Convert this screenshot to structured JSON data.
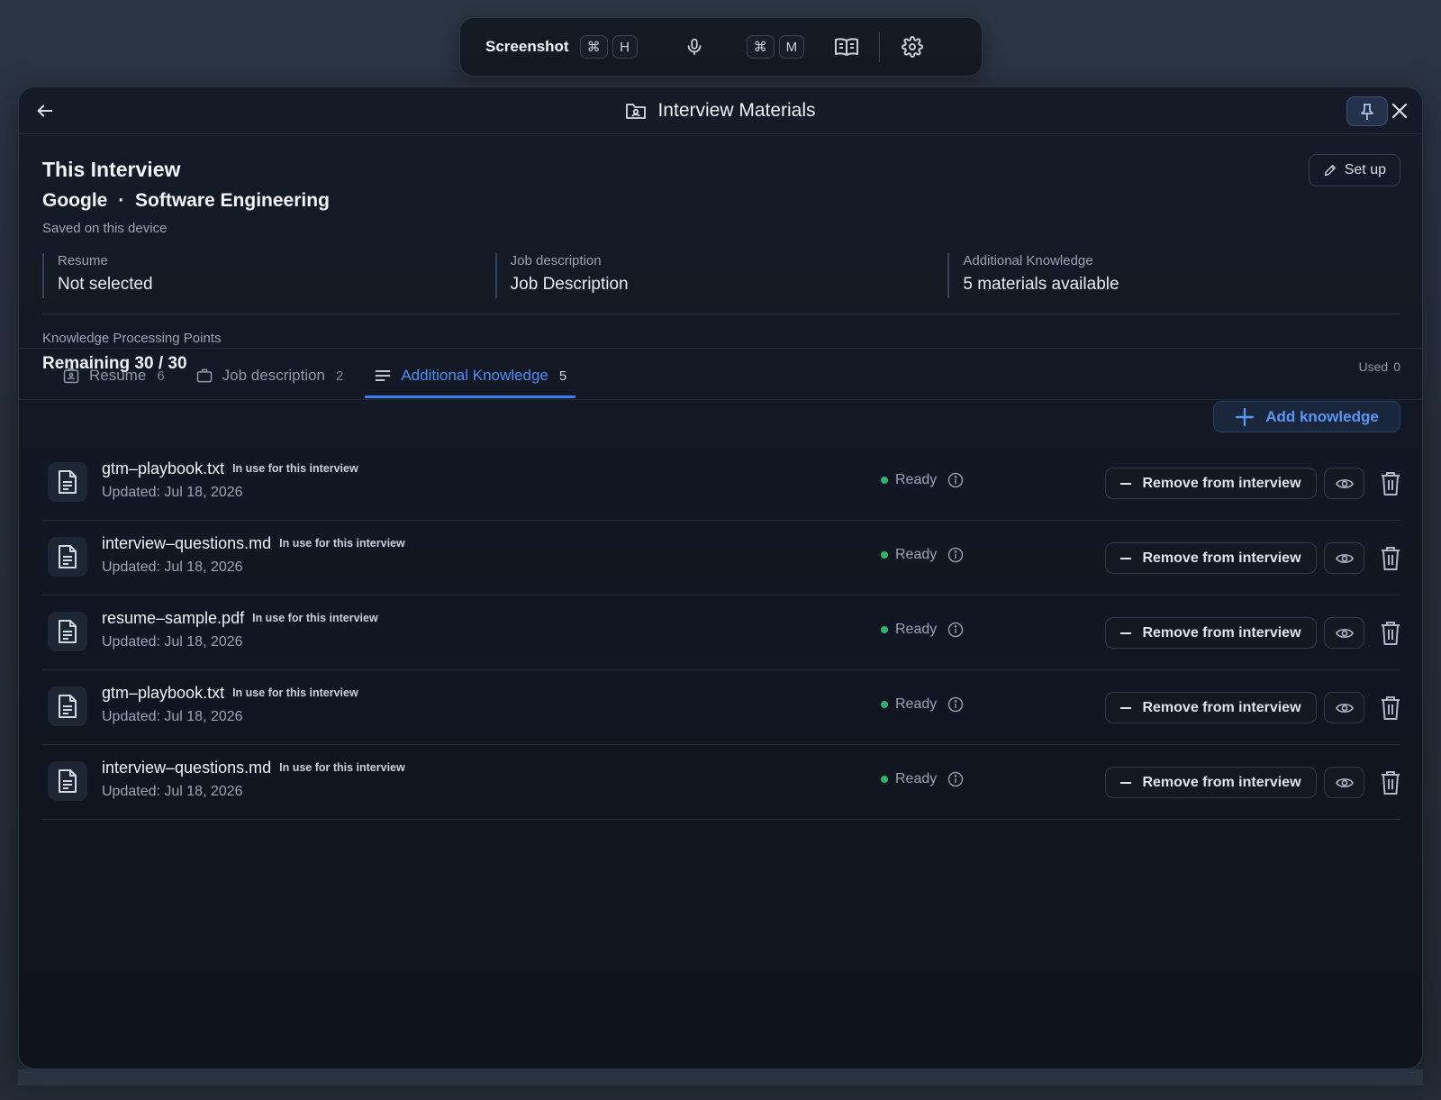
{
  "toolbar": {
    "screenshot_label": "Screenshot",
    "shortcut1_mod": "⌘",
    "shortcut1_key": "H",
    "shortcut2_mod": "⌘",
    "shortcut2_key": "M"
  },
  "panel": {
    "title": "Interview Materials"
  },
  "interview": {
    "heading": "This Interview",
    "company": "Google",
    "separator": "·",
    "role": "Software Engineering",
    "saved": "Saved on this device",
    "setup_label": "Set up"
  },
  "stats": [
    {
      "label": "Resume",
      "value": "Not selected"
    },
    {
      "label": "Job description",
      "value": "Job Description"
    },
    {
      "label": "Additional Knowledge",
      "value": "5 materials available"
    }
  ],
  "points": {
    "label": "Knowledge Processing Points",
    "value": "Remaining 30 / 30",
    "used_label": "Used",
    "used_value": "0"
  },
  "tabs": [
    {
      "label": "Resume",
      "count": "6",
      "active": false
    },
    {
      "label": "Job description",
      "count": "2",
      "active": false
    },
    {
      "label": "Additional Knowledge",
      "count": "5",
      "active": true
    }
  ],
  "add_knowledge_label": "Add knowledge",
  "row_labels": {
    "in_use": "In use for this interview",
    "status": "Ready",
    "remove": "Remove from interview"
  },
  "files": [
    {
      "name": "gtm–playbook.txt",
      "updated": "Updated: Jul 18, 2026"
    },
    {
      "name": "interview–questions.md",
      "updated": "Updated: Jul 18, 2026"
    },
    {
      "name": "resume–sample.pdf",
      "updated": "Updated: Jul 18, 2026"
    },
    {
      "name": "gtm–playbook.txt",
      "updated": "Updated: Jul 18, 2026"
    },
    {
      "name": "interview–questions.md",
      "updated": "Updated: Jul 18, 2026"
    }
  ],
  "colors": {
    "accent": "#3f7ff0",
    "status_ready": "#2fb36b",
    "panel_bg": "#111722"
  }
}
